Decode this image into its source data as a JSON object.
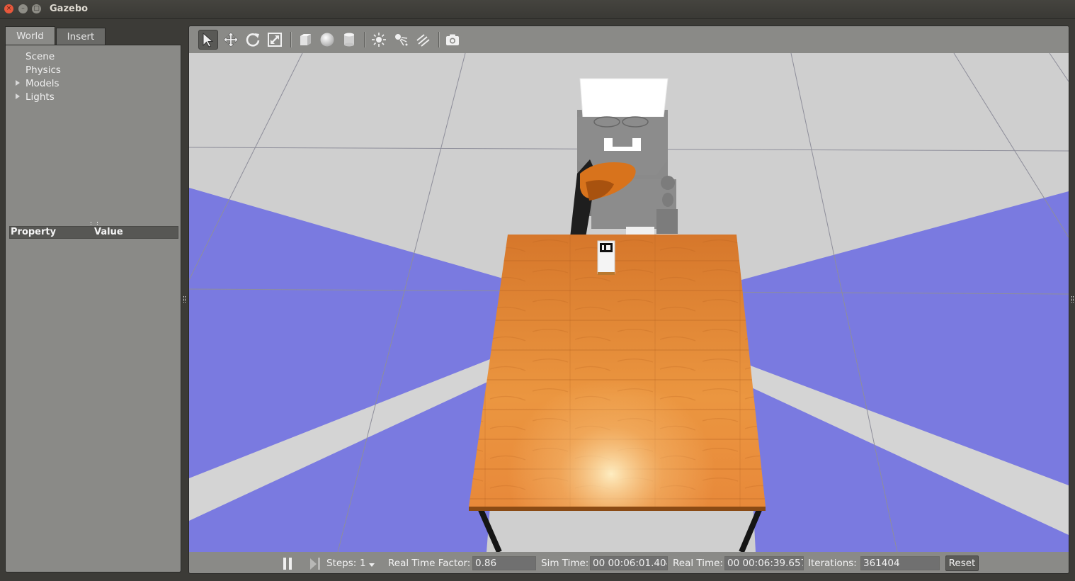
{
  "window": {
    "title": "Gazebo"
  },
  "left_panel": {
    "tabs": [
      {
        "label": "World"
      },
      {
        "label": "Insert"
      }
    ],
    "tree": [
      {
        "label": "Scene",
        "expandable": false
      },
      {
        "label": "Physics",
        "expandable": false
      },
      {
        "label": "Models",
        "expandable": true
      },
      {
        "label": "Lights",
        "expandable": true
      }
    ],
    "property_header": {
      "property": "Property",
      "value": "Value"
    }
  },
  "toolbar": {
    "tools": [
      {
        "icon": "select-arrow-icon",
        "active": true
      },
      {
        "icon": "translate-icon"
      },
      {
        "icon": "rotate-icon"
      },
      {
        "icon": "scale-icon"
      },
      {
        "icon": "box-shape-icon"
      },
      {
        "icon": "sphere-shape-icon"
      },
      {
        "icon": "cylinder-shape-icon"
      },
      {
        "icon": "point-light-icon"
      },
      {
        "icon": "spot-light-icon"
      },
      {
        "icon": "directional-light-icon"
      },
      {
        "icon": "screenshot-camera-icon"
      }
    ]
  },
  "statusbar": {
    "steps_label": "Steps:",
    "steps_value": "1",
    "rtf_label": "Real Time Factor:",
    "rtf_value": "0.86",
    "sim_time_label": "Sim Time:",
    "sim_time_value": "00 00:06:01.404",
    "real_time_label": "Real Time:",
    "real_time_value": "00 00:06:39.657",
    "iterations_label": "Iterations:",
    "iterations_value": "361404",
    "reset_label": "Reset"
  },
  "colors": {
    "ground": "#cfcfcf",
    "laser_region": "#7a7ae0",
    "table_wood": "#e58a36",
    "robot_orange": "#d8731c"
  }
}
